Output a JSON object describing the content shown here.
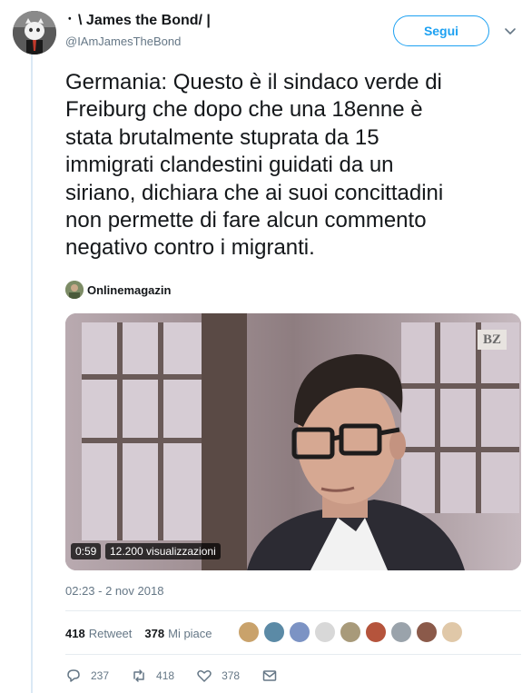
{
  "tweet": {
    "display_name": "᛫ \\ James the Bond/ |",
    "handle": "@IAmJamesTheBond",
    "follow_label": "Segui",
    "text_lines": [
      "Germania: Questo è il sindaco verde di",
      "Freiburg che dopo che una 18enne è",
      "stata brutalmente stuprata da 15",
      "immigrati clandestini guidati da un",
      "siriano, dichiara che ai suoi concittadini",
      "non permette di fare alcun commento",
      "negativo contro i migranti."
    ],
    "source_name": "Onlinemagazin",
    "video": {
      "duration": "0:59",
      "views": "12.200 visualizzazioni",
      "logo": "BZ"
    },
    "timestamp": "02:23 - 2 nov 2018"
  },
  "stats": {
    "retweets_count": "418",
    "retweets_label": "Retweet",
    "likes_count": "378",
    "likes_label": "Mi piace"
  },
  "likers_colors": [
    "#c9a26b",
    "#5b8aa6",
    "#7c93c4",
    "#d8d8d8",
    "#a89a7a",
    "#b5543c",
    "#9aa3ab",
    "#8b5a4a",
    "#e0c8a8"
  ],
  "actions": {
    "reply_count": "237",
    "retweet_count": "418",
    "like_count": "378"
  },
  "icons": {
    "caret": "chevron-down-icon",
    "reply": "reply-icon",
    "retweet": "retweet-icon",
    "like": "heart-icon",
    "dm": "envelope-icon"
  },
  "colors": {
    "accent": "#1da1f2",
    "muted": "#657786",
    "thread_line": "#dbe9f5"
  }
}
